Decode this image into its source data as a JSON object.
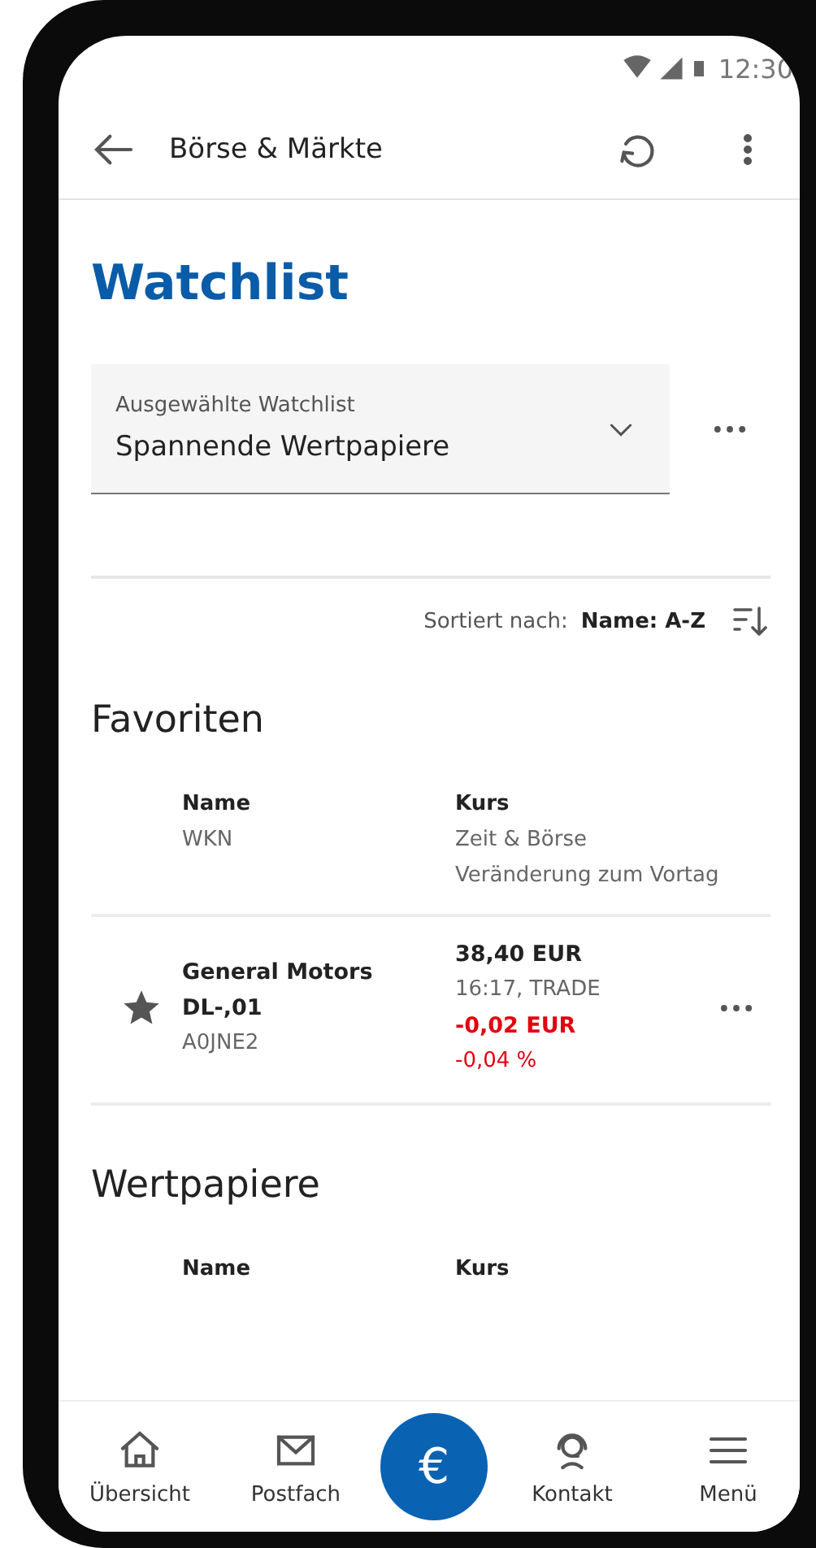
{
  "status_bar": {
    "time": "12:30"
  },
  "app_bar": {
    "title": "Börse & Märkte"
  },
  "page_title": "Watchlist",
  "watchlist_select": {
    "label": "Ausgewählte Watchlist",
    "value": "Spannende Wertpapiere"
  },
  "sort": {
    "label": "Sortiert nach:",
    "value": "Name: A-Z"
  },
  "sections": [
    {
      "title": "Favoriten",
      "columns": [
        [
          "Name",
          "WKN"
        ],
        [
          "Kurs",
          "Zeit & Börse",
          "Veränderung zum Vortag"
        ]
      ],
      "rows": [
        {
          "favorite": true,
          "name": "General Motors DL-,01",
          "wkn": "A0JNE2",
          "price": "38,40 EUR",
          "time_exchange": "16:17, TRADE",
          "change_abs": "-0,02 EUR",
          "change_pct": "-0,04 %"
        }
      ]
    },
    {
      "title": "Wertpapiere",
      "columns": [
        [
          "Name"
        ],
        [
          "Kurs"
        ]
      ]
    }
  ],
  "bottom_nav": [
    {
      "kind": "tab",
      "label": "Übersicht",
      "selected": false
    },
    {
      "kind": "tab",
      "label": "Postfach",
      "selected": false
    },
    {
      "kind": "fab",
      "label": "€",
      "selected": false
    },
    {
      "kind": "tab",
      "label": "Kontakt",
      "selected": false
    },
    {
      "kind": "tab",
      "label": "Menü",
      "selected": false
    }
  ]
}
